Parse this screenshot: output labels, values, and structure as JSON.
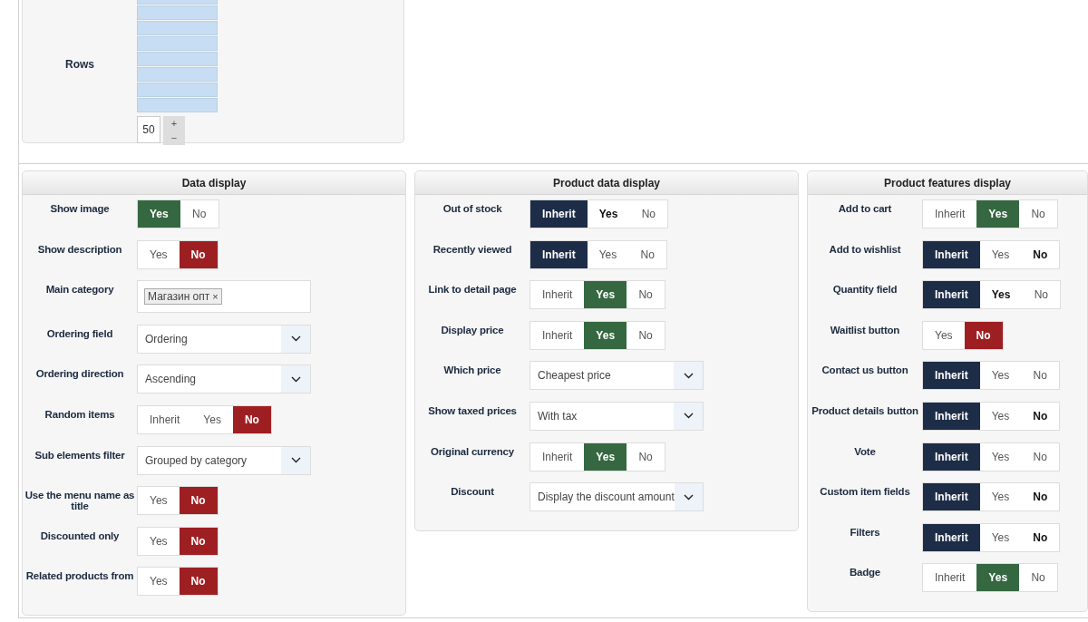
{
  "rows_panel": {
    "label": "Rows",
    "value": "50",
    "increment": "+",
    "decrement": "−"
  },
  "panels": [
    {
      "title": "Data display",
      "fields": [
        {
          "label": "Show image",
          "kind": "toggle",
          "options": [
            {
              "label": "Yes",
              "kind": "yes",
              "selected": true,
              "emphasized": false
            },
            {
              "label": "No",
              "kind": "no",
              "selected": false,
              "emphasized": false
            }
          ]
        },
        {
          "label": "Show description",
          "kind": "toggle",
          "options": [
            {
              "label": "Yes",
              "kind": "yes",
              "selected": false,
              "emphasized": false
            },
            {
              "label": "No",
              "kind": "no",
              "selected": true,
              "emphasized": false
            }
          ]
        },
        {
          "label": "Main category",
          "kind": "tags",
          "tags": [
            "Магазин опт"
          ],
          "remove": "×"
        },
        {
          "label": "Ordering field",
          "kind": "select",
          "value": "Ordering"
        },
        {
          "label": "Ordering direction",
          "kind": "select",
          "value": "Ascending"
        },
        {
          "label": "Random items",
          "kind": "toggle",
          "options": [
            {
              "label": "Inherit",
              "kind": "inherit",
              "selected": false,
              "emphasized": false
            },
            {
              "label": "Yes",
              "kind": "yes",
              "selected": false,
              "emphasized": false
            },
            {
              "label": "No",
              "kind": "no",
              "selected": true,
              "emphasized": false
            }
          ]
        },
        {
          "label": "Sub elements filter",
          "kind": "select",
          "value": "Grouped by category"
        },
        {
          "label": "Use the menu name as title",
          "kind": "toggle",
          "options": [
            {
              "label": "Yes",
              "kind": "yes",
              "selected": false,
              "emphasized": false
            },
            {
              "label": "No",
              "kind": "no",
              "selected": true,
              "emphasized": false
            }
          ]
        },
        {
          "label": "Discounted only",
          "kind": "toggle",
          "options": [
            {
              "label": "Yes",
              "kind": "yes",
              "selected": false,
              "emphasized": false
            },
            {
              "label": "No",
              "kind": "no",
              "selected": true,
              "emphasized": false
            }
          ]
        },
        {
          "label": "Related products from",
          "kind": "toggle",
          "options": [
            {
              "label": "Yes",
              "kind": "yes",
              "selected": false,
              "emphasized": false
            },
            {
              "label": "No",
              "kind": "no",
              "selected": true,
              "emphasized": false
            }
          ]
        }
      ]
    },
    {
      "title": "Product data display",
      "fields": [
        {
          "label": "Out of stock",
          "kind": "toggle",
          "options": [
            {
              "label": "Inherit",
              "kind": "inherit",
              "selected": true,
              "emphasized": false
            },
            {
              "label": "Yes",
              "kind": "yes",
              "selected": false,
              "emphasized": true
            },
            {
              "label": "No",
              "kind": "no",
              "selected": false,
              "emphasized": false
            }
          ]
        },
        {
          "label": "Recently viewed",
          "kind": "toggle",
          "options": [
            {
              "label": "Inherit",
              "kind": "inherit",
              "selected": true,
              "emphasized": false
            },
            {
              "label": "Yes",
              "kind": "yes",
              "selected": false,
              "emphasized": false
            },
            {
              "label": "No",
              "kind": "no",
              "selected": false,
              "emphasized": false
            }
          ]
        },
        {
          "label": "Link to detail page",
          "kind": "toggle",
          "options": [
            {
              "label": "Inherit",
              "kind": "inherit",
              "selected": false,
              "emphasized": false
            },
            {
              "label": "Yes",
              "kind": "yes",
              "selected": true,
              "emphasized": false
            },
            {
              "label": "No",
              "kind": "no",
              "selected": false,
              "emphasized": false
            }
          ]
        },
        {
          "label": "Display price",
          "kind": "toggle",
          "options": [
            {
              "label": "Inherit",
              "kind": "inherit",
              "selected": false,
              "emphasized": false
            },
            {
              "label": "Yes",
              "kind": "yes",
              "selected": true,
              "emphasized": false
            },
            {
              "label": "No",
              "kind": "no",
              "selected": false,
              "emphasized": false
            }
          ]
        },
        {
          "label": "Which price",
          "kind": "select",
          "value": "Cheapest price"
        },
        {
          "label": "Show taxed prices",
          "kind": "select",
          "value": "With tax"
        },
        {
          "label": "Original currency",
          "kind": "toggle",
          "options": [
            {
              "label": "Inherit",
              "kind": "inherit",
              "selected": false,
              "emphasized": false
            },
            {
              "label": "Yes",
              "kind": "yes",
              "selected": true,
              "emphasized": false
            },
            {
              "label": "No",
              "kind": "no",
              "selected": false,
              "emphasized": false
            }
          ]
        },
        {
          "label": "Discount",
          "kind": "select",
          "value": "Display the discount amount"
        }
      ]
    },
    {
      "title": "Product features display",
      "fields": [
        {
          "label": "Add to cart",
          "kind": "toggle",
          "options": [
            {
              "label": "Inherit",
              "kind": "inherit",
              "selected": false,
              "emphasized": false
            },
            {
              "label": "Yes",
              "kind": "yes",
              "selected": true,
              "emphasized": false
            },
            {
              "label": "No",
              "kind": "no",
              "selected": false,
              "emphasized": false
            }
          ]
        },
        {
          "label": "Add to wishlist",
          "kind": "toggle",
          "options": [
            {
              "label": "Inherit",
              "kind": "inherit",
              "selected": true,
              "emphasized": false
            },
            {
              "label": "Yes",
              "kind": "yes",
              "selected": false,
              "emphasized": false
            },
            {
              "label": "No",
              "kind": "no",
              "selected": false,
              "emphasized": true
            }
          ]
        },
        {
          "label": "Quantity field",
          "kind": "toggle",
          "options": [
            {
              "label": "Inherit",
              "kind": "inherit",
              "selected": true,
              "emphasized": false
            },
            {
              "label": "Yes",
              "kind": "yes",
              "selected": false,
              "emphasized": true
            },
            {
              "label": "No",
              "kind": "no",
              "selected": false,
              "emphasized": false
            }
          ]
        },
        {
          "label": "Waitlist button",
          "kind": "toggle",
          "options": [
            {
              "label": "Yes",
              "kind": "yes",
              "selected": false,
              "emphasized": false
            },
            {
              "label": "No",
              "kind": "no",
              "selected": true,
              "emphasized": false
            }
          ]
        },
        {
          "label": "Contact us button",
          "kind": "toggle",
          "options": [
            {
              "label": "Inherit",
              "kind": "inherit",
              "selected": true,
              "emphasized": false
            },
            {
              "label": "Yes",
              "kind": "yes",
              "selected": false,
              "emphasized": false
            },
            {
              "label": "No",
              "kind": "no",
              "selected": false,
              "emphasized": false
            }
          ]
        },
        {
          "label": "Product details button",
          "kind": "toggle",
          "options": [
            {
              "label": "Inherit",
              "kind": "inherit",
              "selected": true,
              "emphasized": false
            },
            {
              "label": "Yes",
              "kind": "yes",
              "selected": false,
              "emphasized": false
            },
            {
              "label": "No",
              "kind": "no",
              "selected": false,
              "emphasized": true
            }
          ]
        },
        {
          "label": "Vote",
          "kind": "toggle",
          "options": [
            {
              "label": "Inherit",
              "kind": "inherit",
              "selected": true,
              "emphasized": false
            },
            {
              "label": "Yes",
              "kind": "yes",
              "selected": false,
              "emphasized": false
            },
            {
              "label": "No",
              "kind": "no",
              "selected": false,
              "emphasized": false
            }
          ]
        },
        {
          "label": "Custom item fields",
          "kind": "toggle",
          "options": [
            {
              "label": "Inherit",
              "kind": "inherit",
              "selected": true,
              "emphasized": false
            },
            {
              "label": "Yes",
              "kind": "yes",
              "selected": false,
              "emphasized": false
            },
            {
              "label": "No",
              "kind": "no",
              "selected": false,
              "emphasized": true
            }
          ]
        },
        {
          "label": "Filters",
          "kind": "toggle",
          "options": [
            {
              "label": "Inherit",
              "kind": "inherit",
              "selected": true,
              "emphasized": false
            },
            {
              "label": "Yes",
              "kind": "yes",
              "selected": false,
              "emphasized": false
            },
            {
              "label": "No",
              "kind": "no",
              "selected": false,
              "emphasized": true
            }
          ]
        },
        {
          "label": "Badge",
          "kind": "toggle",
          "options": [
            {
              "label": "Inherit",
              "kind": "inherit",
              "selected": false,
              "emphasized": false
            },
            {
              "label": "Yes",
              "kind": "yes",
              "selected": true,
              "emphasized": false
            },
            {
              "label": "No",
              "kind": "no",
              "selected": false,
              "emphasized": false
            }
          ]
        }
      ]
    }
  ]
}
